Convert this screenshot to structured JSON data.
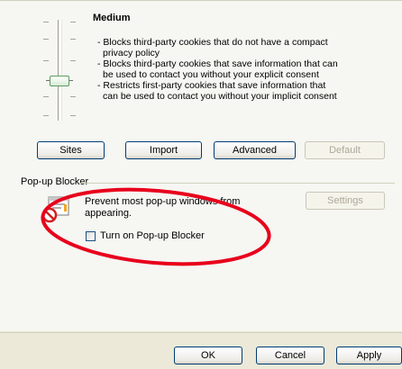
{
  "privacy": {
    "level": "Medium",
    "descriptions": [
      "- Blocks third-party cookies that do not have a compact",
      "privacy policy",
      "- Blocks third-party cookies that save information that can",
      "be used to contact you without your explicit consent",
      "- Restricts first-party cookies that save information that",
      "can be used to contact you without your implicit consent"
    ],
    "buttons": {
      "sites": "Sites",
      "import": "Import",
      "advanced": "Advanced",
      "default": "Default"
    }
  },
  "popup_blocker": {
    "section_label": "Pop-up Blocker",
    "description_line1": "Prevent most pop-up windows from",
    "description_line2": "appearing.",
    "settings_button": "Settings",
    "checkbox_label": "Turn on Pop-up Blocker",
    "checkbox_checked": false
  },
  "dialog_buttons": {
    "ok": "OK",
    "cancel": "Cancel",
    "apply": "Apply"
  },
  "annotation": {
    "color": "#e8001c"
  }
}
